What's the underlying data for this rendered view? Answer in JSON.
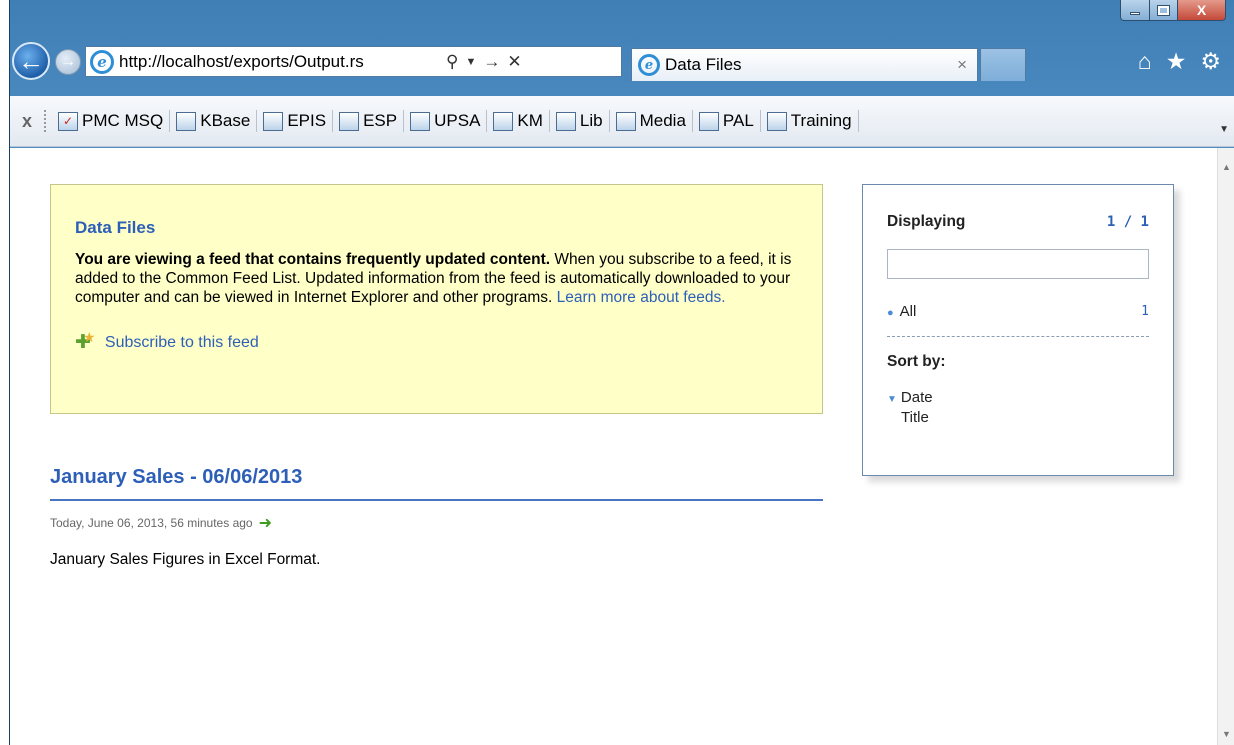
{
  "browser": {
    "url": "http://localhost/exports/Output.rs",
    "address_icons": [
      "search-icon",
      "dropdown-icon",
      "go-icon",
      "stop-icon"
    ],
    "tab": {
      "title": "Data Files",
      "close": "×"
    },
    "caption": {
      "close": "X"
    }
  },
  "favorites": {
    "close": "x",
    "items": [
      {
        "label": "PMC MSQ",
        "icon": "check-icon"
      },
      {
        "label": "KBase",
        "icon": "page-icon"
      },
      {
        "label": "EPIS",
        "icon": "page-icon"
      },
      {
        "label": "ESP",
        "icon": "page-icon"
      },
      {
        "label": "UPSA",
        "icon": "page-icon"
      },
      {
        "label": "KM",
        "icon": "page-icon"
      },
      {
        "label": "Lib",
        "icon": "page-icon"
      },
      {
        "label": "Media",
        "icon": "page-icon"
      },
      {
        "label": "PAL",
        "icon": "page-icon"
      },
      {
        "label": "Training",
        "icon": "page-icon"
      }
    ]
  },
  "feed": {
    "title": "Data Files",
    "intro_bold": "You are viewing a feed that contains frequently updated content.",
    "intro_text": " When you subscribe to a feed, it is added to the Common Feed List. Updated information from the feed is automatically downloaded to your computer and can be viewed in Internet Explorer and other programs. ",
    "learn_more": "Learn more about feeds.",
    "subscribe": "Subscribe to this feed"
  },
  "entry": {
    "title": "January Sales - 06/06/2013",
    "date": "Today, June 06, 2013, 56 minutes ago",
    "body": "January Sales Figures in Excel Format."
  },
  "filter": {
    "displaying_label": "Displaying",
    "displaying_count": "1 / 1",
    "search_value": "",
    "all_label": "All",
    "all_count": "1",
    "sort_label": "Sort by:",
    "sort_options": [
      "Date",
      "Title"
    ]
  }
}
